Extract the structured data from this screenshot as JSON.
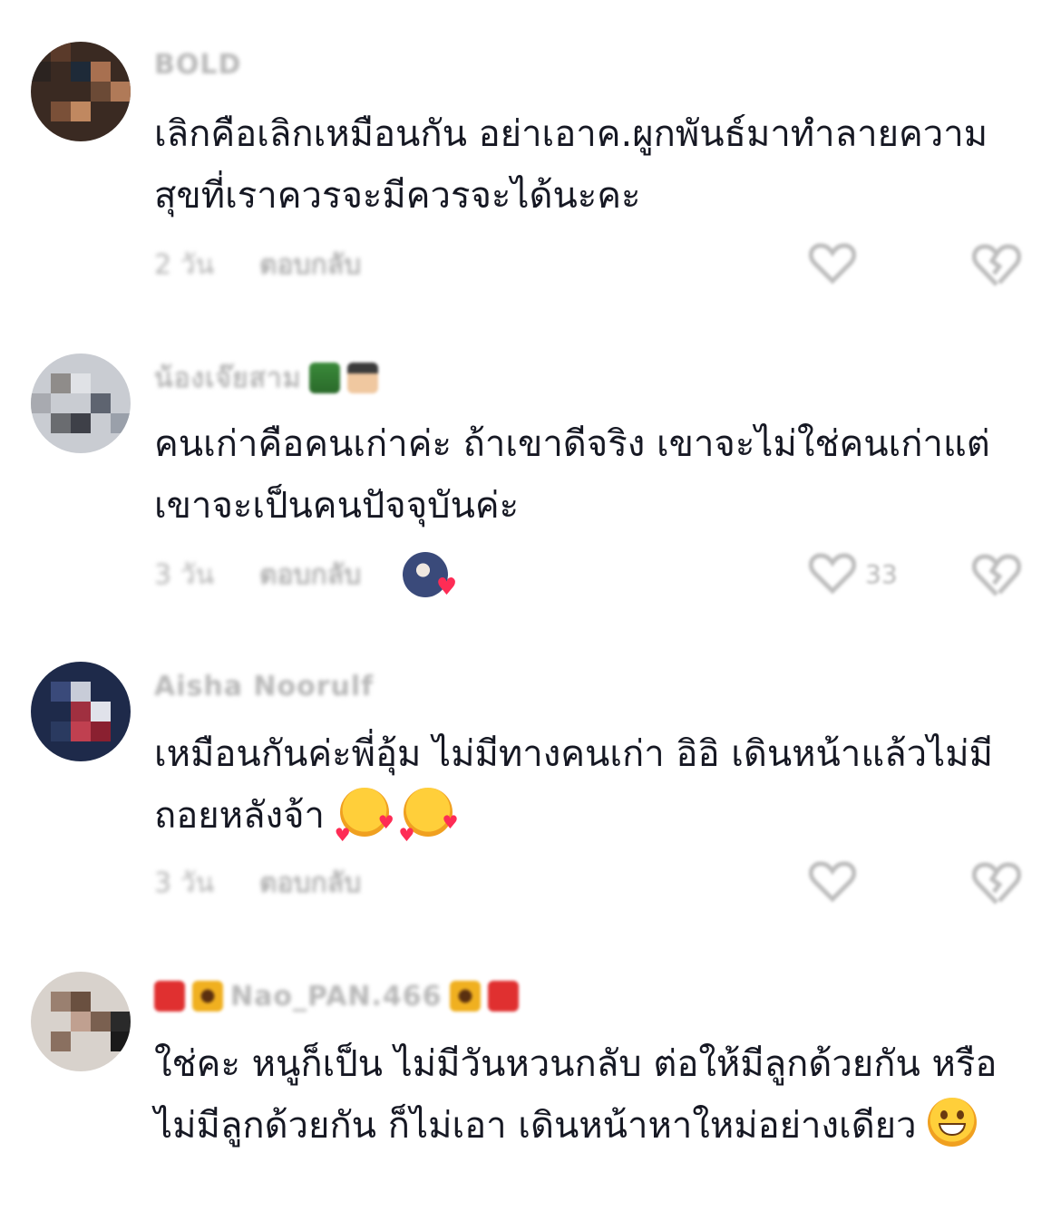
{
  "comments": [
    {
      "username": "BOLD",
      "text": "เลิกคือเลิกเหมือนกัน อย่าเอาค.ผูกพันธ์มาทำลายความสุขที่เราควรจะมีควรจะได้นะคะ",
      "time": "2 วัน",
      "reply_label": "ตอบกลับ",
      "like_count": "",
      "creator_liked": false,
      "avatar_colors": [
        "#3a2a22",
        "#6b4a36",
        "#a87050",
        "#2b2320"
      ]
    },
    {
      "username": "น้องเจ๊ยสาม",
      "name_emojis": [
        "tree-emoji",
        "face-emoji"
      ],
      "text": "คนเก่าคือคนเก่าค่ะ ถ้าเขาดีจริง เขาจะไม่ใช่คนเก่าแต่เขาจะเป็นคนปัจจุบันค่ะ",
      "time": "3 วัน",
      "reply_label": "ตอบกลับ",
      "like_count": "33",
      "creator_liked": true,
      "avatar_colors": [
        "#c9ccd2",
        "#8f8c8a",
        "#5e6470",
        "#e0e2e6"
      ]
    },
    {
      "username": "Aisha Noorulf",
      "text": "เหมือนกันค่ะพี่อุ้ม ไม่มีทางคนเก่า อิอิ เดินหน้าแล้วไม่มีถอยหลังจ้า",
      "text_emojis": [
        "smiling-face-with-hearts",
        "smiling-face-with-hearts"
      ],
      "time": "3 วัน",
      "reply_label": "ตอบกลับ",
      "like_count": "",
      "creator_liked": false,
      "avatar_colors": [
        "#1e2a4a",
        "#c8ccd8",
        "#a03040",
        "#3a4a7a"
      ]
    },
    {
      "username": "Nao_PAN.466",
      "name_emojis_left": [
        "red-badge-emoji",
        "sunflower-emoji"
      ],
      "name_emojis_right": [
        "sunflower-emoji",
        "red-badge-emoji"
      ],
      "text": "ใช่คะ หนูก็เป็น ไม่มีวันหวนกลับ ต่อให้มีลูกด้วยกัน หรือ ไม่มีลูกด้วยกัน ก็ไม่เอา เดินหน้าหาใหม่อย่างเดียว",
      "text_emojis": [
        "grinning-face"
      ],
      "avatar_colors": [
        "#d8d2cc",
        "#9a8070",
        "#6a5040",
        "#e8e4e0"
      ]
    }
  ],
  "colors": {
    "text": "#161823",
    "muted": "#b3b3b3",
    "heart": "#fe2c55"
  }
}
